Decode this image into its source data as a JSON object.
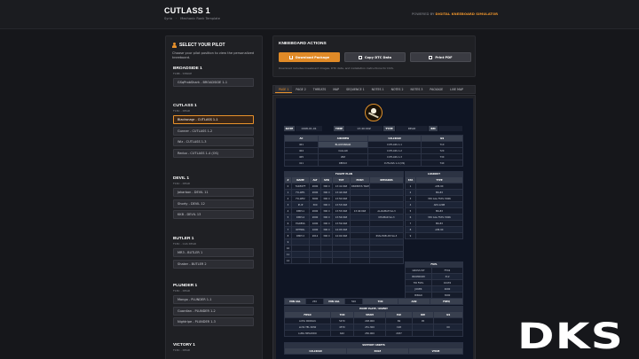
{
  "header": {
    "title": "CUTLASS 1",
    "meta": [
      "Syria",
      "Mechanic Rank Template"
    ],
    "powered_prefix": "POWERED BY",
    "powered_brand": "DIGITAL KNEEBOARD SIMULATOR"
  },
  "pilot_panel": {
    "title": "SELECT YOUR PILOT",
    "description": "Choose your pilot position to view the personalized kneeboard.",
    "flights": [
      {
        "name": "BROADSIDE 1",
        "sub": "F18B - STRIKE",
        "pilots": [
          "GSqProbShark - BROADSIDE 1-1"
        ]
      },
      {
        "name": "CUTLASS 1",
        "sub": "F18C - DEAD",
        "pilots": [
          "Blacksnagr - CUTLASS 1-1",
          "Gunner - CUTLASS 1-2",
          "Wiz - CUTLASS 1-3",
          "Redux - CUTLASS 1-4 (OS)"
        ]
      },
      {
        "name": "DEVIL 1",
        "sub": "F16C - DEAD",
        "pilots": [
          "Jakarbon - DEVIL 11",
          "Shorty - DEVIL 12",
          "KKB - DEVIL 13"
        ]
      },
      {
        "name": "BUTLER 1",
        "sub": "F18C - CAS DEAD",
        "pilots": [
          "MR3 - BUTLER 1",
          "Shaker - BUTLER 2"
        ]
      },
      {
        "name": "PLUNDER 1",
        "sub": "F18C - DEAD",
        "pilots": [
          "Mongo - PLUNDER 1-1",
          "Guardian - PLUNDER 1-2",
          "Nightripe - PLUNDER 1-3"
        ]
      },
      {
        "name": "VICTORY 1",
        "sub": "F18C - DEAD",
        "pilots": []
      }
    ]
  },
  "actions": {
    "title": "KNEEBOARD ACTIONS",
    "download": "Download Package",
    "copy": "Copy DTC Data",
    "print": "Print PDF",
    "note": "Download includes kneeboard images, DTC data, and installation instructions for DCS."
  },
  "tabs": [
    "PAGE 1",
    "PAGE 2",
    "THREATS",
    "MAP",
    "SEQUENCE 1",
    "NOTES 1",
    "NOTES 2",
    "NOTES 3",
    "PACKAGE",
    "LIVE MAP"
  ],
  "doc": {
    "info": {
      "date_label": "DATE",
      "date": "1998-01-01",
      "time_label": "TIME",
      "time": "13:40:00Z",
      "type_label": "TYPE",
      "type": "DEAD",
      "bm_label": "BM",
      "bm": ""
    },
    "aircrew": {
      "headers": [
        "AC",
        "AIRCREW",
        "CALLSIGN",
        "ILS"
      ],
      "rows": [
        [
          "401",
          "BLACKSNAGR",
          "CUTLASS 1-1",
          "71X"
        ],
        [
          "404",
          "CALLAN",
          "CUTLASS 1-2",
          "72X"
        ],
        [
          "405",
          "WIZ",
          "CUTLASS 1-3",
          "73X"
        ],
        [
          "411",
          "REDUX",
          "CUTLASS 1-4 (OS)",
          "74X"
        ]
      ]
    },
    "flight_plan": {
      "caption": "FLIGHT PLAN",
      "headers": [
        "#",
        "NAME",
        "ALT",
        "SPD",
        "TOT",
        "PUSH",
        "REMARKS"
      ],
      "rows": [
        [
          "0",
          "TAKEOFF",
          "2000",
          "300 C",
          "13:41:00Z",
          "RNDEZVS TAKEOFF",
          ""
        ],
        [
          "1",
          "FO-WP1",
          "2000",
          "300 C",
          "13:44:00Z",
          "",
          ""
        ],
        [
          "2",
          "FO-WP2",
          "3000",
          "300 C",
          "13:50:00Z",
          "",
          ""
        ],
        [
          "3",
          "IP-IP",
          "300",
          "300 C",
          "13:53:00Z",
          "",
          ""
        ],
        [
          "4",
          "DMPI-1",
          "2000",
          "300 C",
          "13:55:00Z",
          "13:40:00Z",
          "AL-RAMAH SA-3"
        ],
        [
          "5",
          "DMPI-4",
          "2000",
          "300 C",
          "13:56:00Z",
          "",
          "KHAMAR SA-3"
        ],
        [
          "6",
          "EGRESS",
          "1000",
          "300 C",
          "13:59:00Z",
          "",
          ""
        ],
        [
          "7",
          "RETNRL",
          "1000",
          "300 C",
          "14:05:00Z",
          "",
          ""
        ],
        [
          "8",
          "DMPI 2",
          "2012",
          "300 C",
          "14:02:00Z",
          "",
          "RYALHOB AM SA-3"
        ],
        [
          "9",
          "",
          "",
          "",
          "",
          "",
          ""
        ],
        [
          "10",
          "",
          "",
          "",
          "",
          "",
          ""
        ],
        [
          "11",
          "",
          "",
          "",
          "",
          "",
          ""
        ],
        [
          "12",
          "",
          "",
          "",
          "",
          "",
          ""
        ]
      ]
    },
    "loadout": {
      "caption": "LOADOUT",
      "headers": [
        "STA",
        "TYPE"
      ],
      "rows": [
        [
          "1",
          "AIM-9X"
        ],
        [
          "2",
          "MK-83"
        ],
        [
          "3",
          "330 GAL FUEL TANK"
        ],
        [
          "4",
          "AIM-120B"
        ],
        [
          "5",
          "MK-83"
        ],
        [
          "6",
          "330 GAL FUEL TANK"
        ],
        [
          "7",
          "MK-83"
        ],
        [
          "8",
          "AIM-9X"
        ],
        [
          "9",
          ""
        ]
      ]
    },
    "fuel": {
      "caption": "FUEL",
      "rows": [
        [
          "GROSS WT",
          "FTD2"
        ],
        [
          "BOOMDOM",
          "312"
        ],
        [
          "TIR FUEL",
          "10476"
        ],
        [
          "JOKER",
          "4000"
        ],
        [
          "BINGO",
          "3000"
        ]
      ]
    },
    "bottom_bar": [
      "MIN AGL",
      "250",
      "MIN AGL",
      "500",
      "TCN",
      "AAR",
      "FREQ"
    ],
    "home_plate": {
      "caption": "HOME PLATE / DIVERT",
      "headers": [
        "FIELD",
        "TCN",
        "VHAM",
        "ELV",
        "RW",
        "ILS"
      ],
      "rows": [
        [
          "LCHA INCIRLIK",
          "54TX",
          "228.000",
          "69",
          "05",
          ""
        ],
        [
          "LLHA TEL NOW",
          "45TX",
          "251.300",
          "198",
          "",
          "09"
        ],
        [
          "LLMG MEGIDDO",
          "64X",
          "250.000",
          "2037",
          "",
          ""
        ]
      ]
    },
    "support": {
      "caption": "SUPPORT ASSETS",
      "headers": [
        "CALLSIGN",
        "ROLE",
        "VHAM"
      ]
    }
  },
  "watermark": "DKS"
}
